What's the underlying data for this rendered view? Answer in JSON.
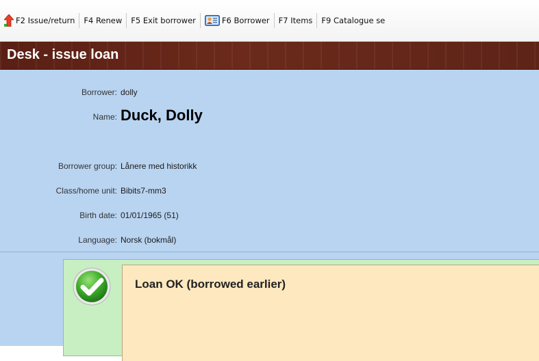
{
  "toolbar": {
    "items": [
      {
        "key": "F2",
        "label": "F2 Issue/return",
        "icon": "red-up-arrow-icon"
      },
      {
        "key": "F4",
        "label": "F4 Renew"
      },
      {
        "key": "F5",
        "label": "F5 Exit borrower"
      },
      {
        "key": "F6",
        "label": "F6 Borrower",
        "icon": "borrower-card-icon"
      },
      {
        "key": "F7",
        "label": "F7 Items"
      },
      {
        "key": "F9",
        "label": "F9 Catalogue se"
      }
    ]
  },
  "header": {
    "title": "Desk - issue loan"
  },
  "borrower": {
    "borrower_label": "Borrower:",
    "borrower_value": "dolly",
    "name_label": "Name:",
    "name_value": "Duck, Dolly",
    "group_label": "Borrower group:",
    "group_value": "Lånere med historikk",
    "class_label": "Class/home unit:",
    "class_value": "Bibits7-mm3",
    "birth_label": "Birth date:",
    "birth_value": "01/01/1965 (51)",
    "language_label": "Language:",
    "language_value": "Norsk (bokmål)"
  },
  "status": {
    "message": "Loan OK (borrowed earlier)",
    "icon": "green-check-icon"
  },
  "colors": {
    "header_bg": "#6b2a1b",
    "info_bg": "#b9d4f1",
    "status_frame": "#c8efc2",
    "status_box": "#fde8bf"
  }
}
